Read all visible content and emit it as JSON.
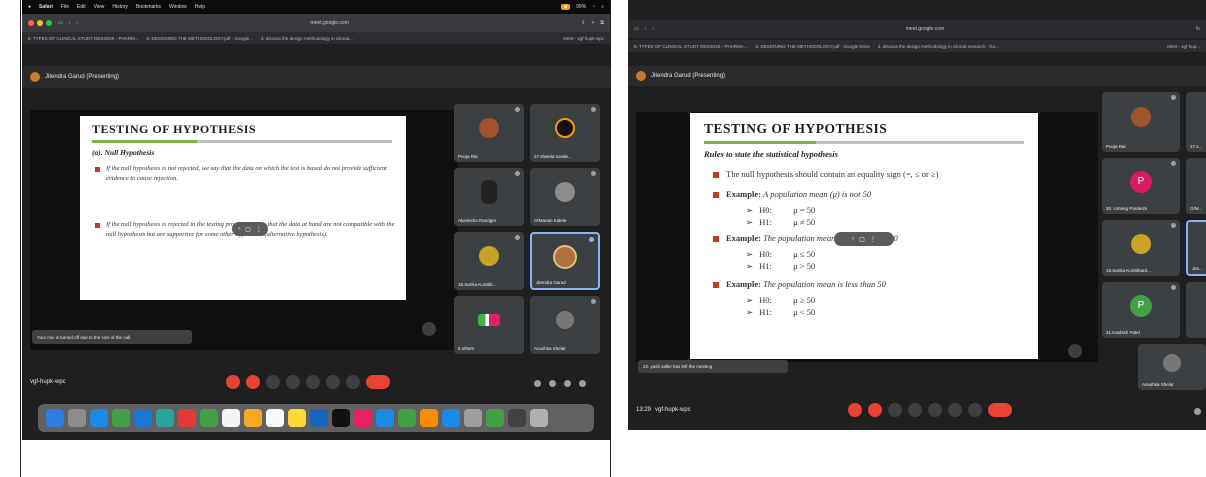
{
  "shotA": {
    "menubar": {
      "apple": "",
      "app": "Safari",
      "items": [
        "File",
        "Edit",
        "View",
        "History",
        "Bookmarks",
        "Window",
        "Help"
      ],
      "battery": "99%"
    },
    "url": "meet.google.com",
    "tabs": [
      "6. TYPES OF CLINICAL STUDY DESIGNS - PHARM...",
      "5. DESIGNING THE METHODOLOGY.pdf - Google...",
      "3. discuss the design methodology in clinical...",
      "Meet - vgf-hupk-wpc"
    ],
    "presenter": "Jitendra Garud (Presenting)",
    "slide": {
      "title": "TESTING OF HYPOTHESIS",
      "subtitle": "(a). Null Hypothesis",
      "bullet1": "If the null hypothesis is not rejected, we say that the data on which the test is based do not provide sufficient evidence to cause rejection.",
      "bullet2": "If the null hypothesis is rejected in the testing process, we say that the data at hand are not compatible with the null hypothesis but are supportive for some other hypothesis (alternative hypothesis)."
    },
    "participants": [
      "Pooja Rai",
      "27.shweta sonde...",
      "Akanksha Randger",
      "O/Manan Kalele",
      "15.Sarika Kumbh...",
      "Jitendra Garud",
      "8 others",
      "Anushka Shelar"
    ],
    "toast": "Your mic is turned off due to the size of the call",
    "meeting_code": "vgf-hupk-wpc"
  },
  "shotB": {
    "url": "meet.google.com",
    "tabs": [
      "6. TYPES OF CLINICAL STUDY DESIGNS - PHARMA...",
      "5. DESIGNING THE METHODOLOGY.pdf - Google Drive",
      "3. discuss the design methodology in clinical research - Go...",
      "Meet - vgf-hup..."
    ],
    "presenter": "Jitendra Garud (Presenting)",
    "slide": {
      "title": "TESTING OF HYPOTHESIS",
      "subtitle": "Rules to state the statistical hypothesis",
      "rule": "The null hypothesis should contain an equality sign (=, ≤ or ≥)",
      "ex1_label": "Example:",
      "ex1_text": "A population mean (μ) is not 50",
      "ex1_h0": "μ = 50",
      "ex1_h1": "μ ≠ 50",
      "ex2_label": "Example:",
      "ex2_text": "The population mean is greater than 50",
      "ex2_h0": "μ ≤ 50",
      "ex2_h1": "μ > 50",
      "ex3_label": "Example:",
      "ex3_text": "The population mean is less than 50",
      "ex3_h0": "μ ≥ 50",
      "ex3_h1": "μ < 50",
      "h0": "H0:",
      "h1": "H1:",
      "arrow": "➢"
    },
    "participants": [
      "Pooja Rai",
      "27.s...",
      "20. Umang Pardeshi",
      "O/M...",
      "15.Sarika Kumbhard...",
      "Jite...",
      "21.Kashish Patel",
      "Anushka Shelar"
    ],
    "initials": {
      "umang": "P",
      "kashish": "P"
    },
    "toast": "22. yash salke has left the meeting",
    "time": "13:29",
    "meeting_code": "vgf-hupk-wpc"
  },
  "colors": {
    "accent_red": "#ea4335",
    "slide_bullet": "#c0392b",
    "active_tile": "#8ab4f8",
    "umang_avatar": "#d81b60",
    "kashish_avatar": "#43a047"
  }
}
